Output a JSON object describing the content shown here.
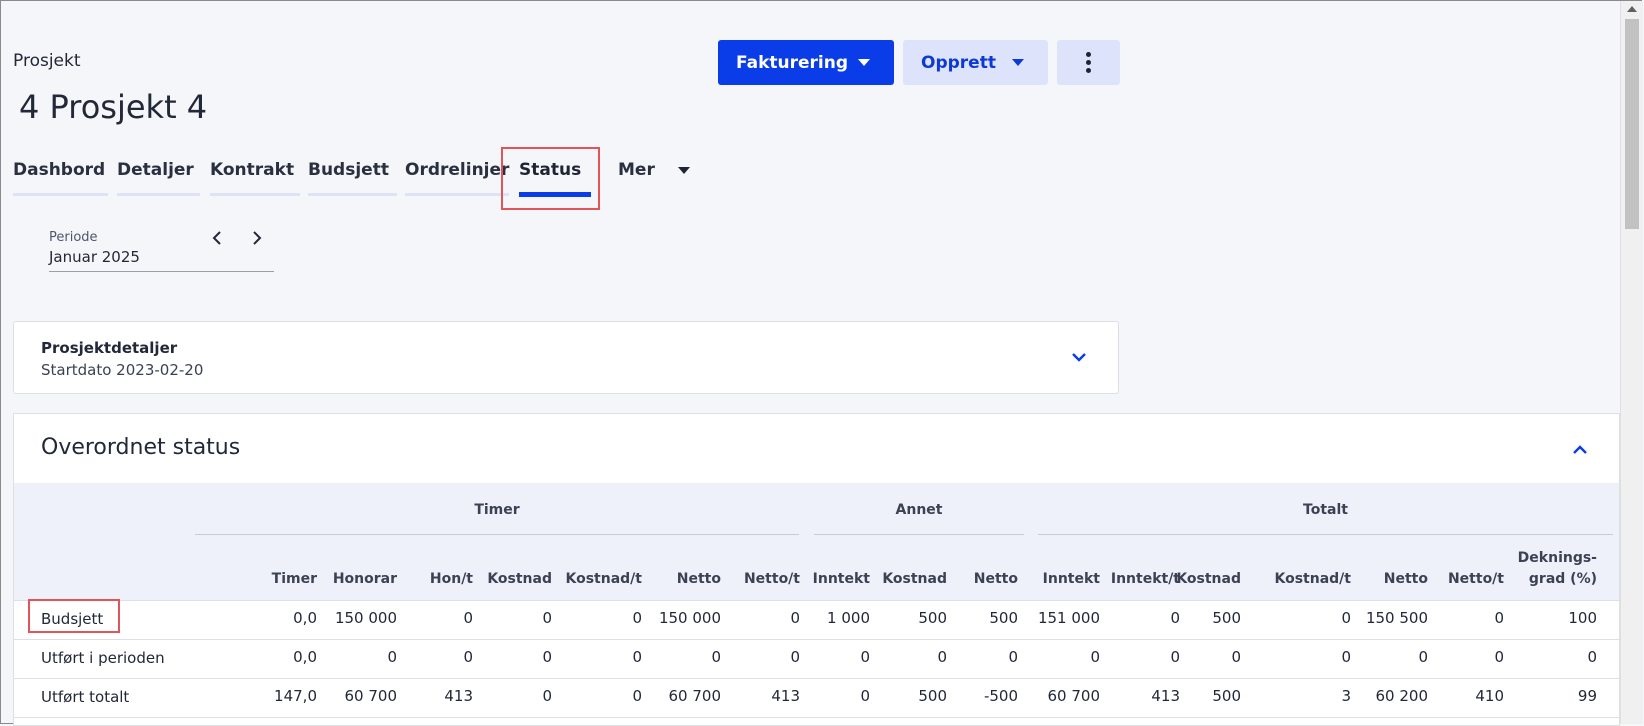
{
  "breadcrumb": "Prosjekt",
  "title": "4 Prosjekt 4",
  "actions": {
    "primary_label": "Fakturering",
    "secondary_label": "Opprett",
    "more_icon": "kebab-icon"
  },
  "tabs": [
    {
      "label": "Dashbord"
    },
    {
      "label": "Detaljer"
    },
    {
      "label": "Kontrakt"
    },
    {
      "label": "Budsjett"
    },
    {
      "label": "Ordrelinjer"
    },
    {
      "label": "Status",
      "active": true
    },
    {
      "label": "Mer"
    }
  ],
  "period": {
    "label": "Periode",
    "value": "Januar 2025"
  },
  "details_card": {
    "title": "Prosjektdetaljer",
    "subtitle": "Startdato 2023-02-20"
  },
  "status_panel": {
    "title": "Overordnet status",
    "groups": [
      "Timer",
      "Annet",
      "Totalt"
    ],
    "columns": [
      "Timer",
      "Honorar",
      "Hon/t",
      "Kostnad",
      "Kostnad/t",
      "Netto",
      "Netto/t",
      "Inntekt",
      "Kostnad",
      "Netto",
      "Inntekt",
      "Inntekt/t",
      "Kostnad",
      "Kostnad/t",
      "Netto",
      "Netto/t",
      "Deknings-",
      "grad (%)"
    ],
    "rows": [
      {
        "label": "Budsjett",
        "values": [
          "0,0",
          "150 000",
          "0",
          "0",
          "0",
          "150 000",
          "0",
          "1 000",
          "500",
          "500",
          "151 000",
          "0",
          "500",
          "0",
          "150 500",
          "0",
          "100"
        ]
      },
      {
        "label": "Utført i perioden",
        "values": [
          "0,0",
          "0",
          "0",
          "0",
          "0",
          "0",
          "0",
          "0",
          "0",
          "0",
          "0",
          "0",
          "0",
          "0",
          "0",
          "0",
          "0"
        ]
      },
      {
        "label": "Utført totalt",
        "values": [
          "147,0",
          "60 700",
          "413",
          "0",
          "0",
          "60 700",
          "413",
          "0",
          "500",
          "-500",
          "60 700",
          "413",
          "500",
          "3",
          "60 200",
          "410",
          "99"
        ]
      }
    ]
  },
  "colors": {
    "primary": "#0a3de8",
    "secondary_bg": "#dde3fa",
    "highlight": "#e0545a"
  }
}
